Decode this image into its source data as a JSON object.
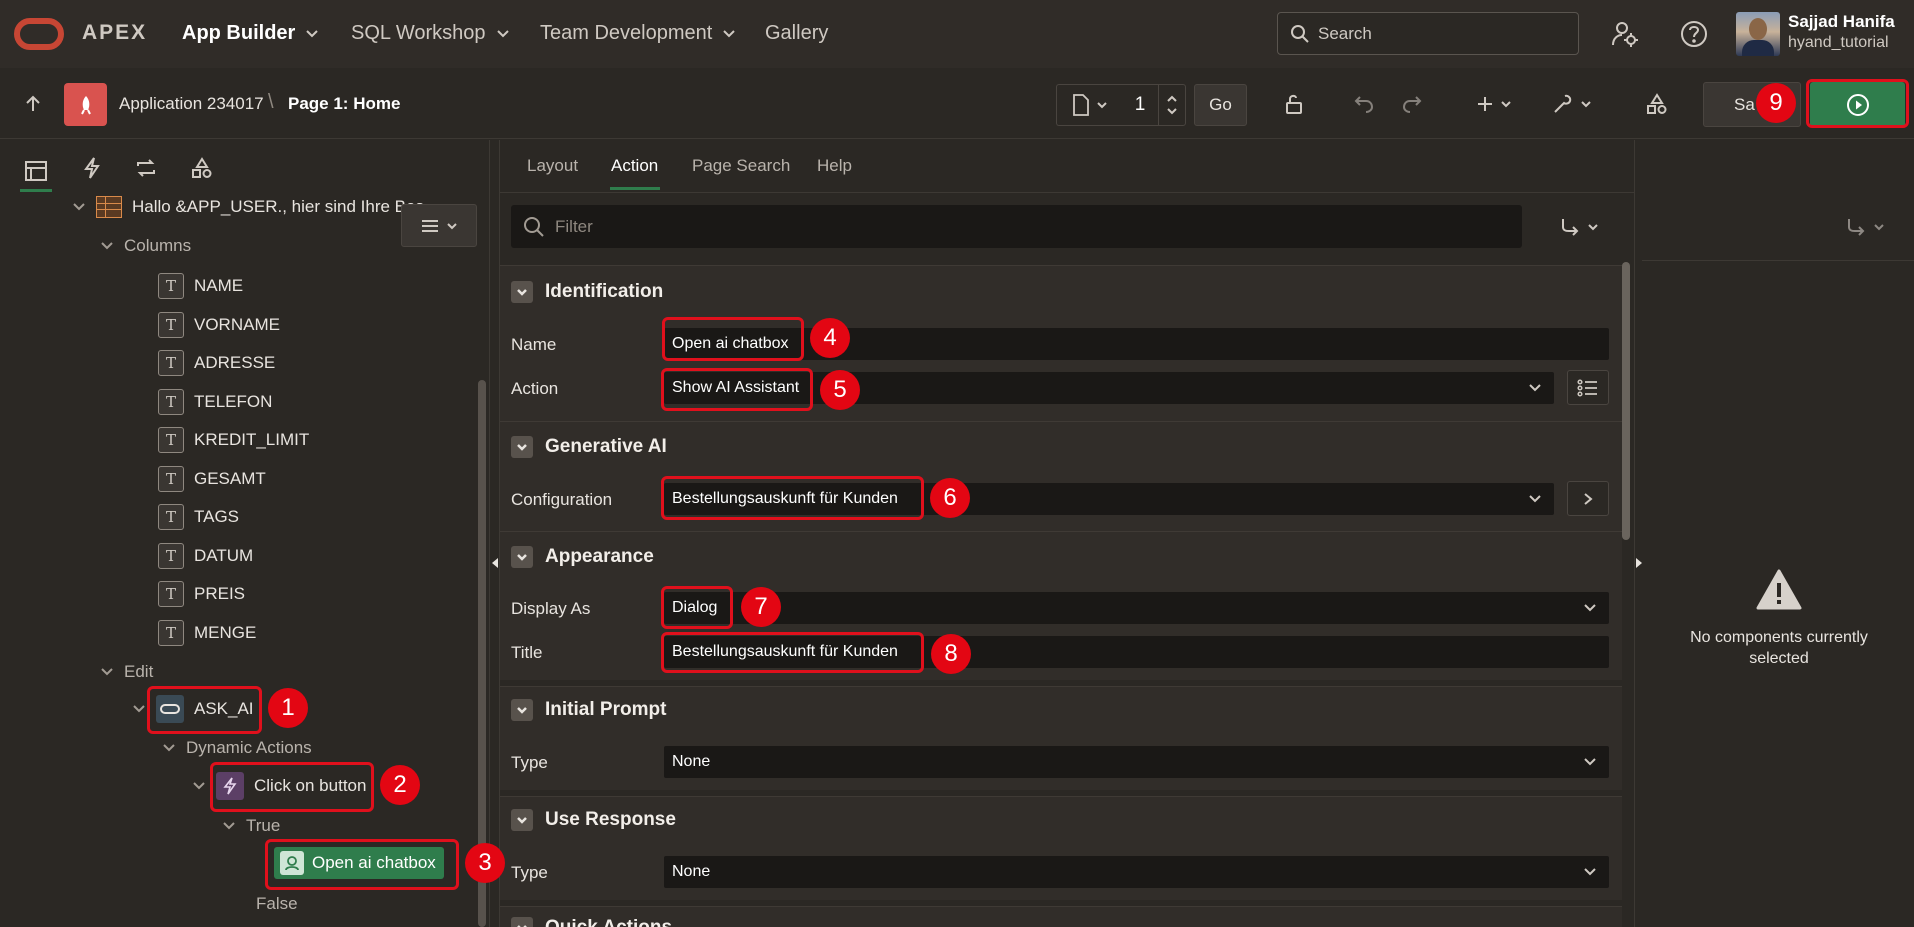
{
  "topnav": {
    "brand": "APEX",
    "items": [
      {
        "label": "App Builder",
        "active": true,
        "has_menu": true
      },
      {
        "label": "SQL Workshop",
        "has_menu": true
      },
      {
        "label": "Team Development",
        "has_menu": true
      },
      {
        "label": "Gallery",
        "has_menu": false
      }
    ],
    "search_placeholder": "Search",
    "user": {
      "name": "Sajjad Hanifa",
      "workspace": "hyand_tutorial"
    }
  },
  "toolbar": {
    "app_link": "Application 234017",
    "page_title": "Page 1: Home",
    "page_number": "1",
    "go_label": "Go",
    "save_label": "Sa",
    "colors": {
      "run_button": "#2f7d4c",
      "app_icon": "#d9534f"
    }
  },
  "tree": {
    "region_label": "Hallo &APP_USER., hier sind Ihre Bes",
    "columns_label": "Columns",
    "columns": [
      "NAME",
      "VORNAME",
      "ADRESSE",
      "TELEFON",
      "KREDIT_LIMIT",
      "GESAMT",
      "TAGS",
      "DATUM",
      "PREIS",
      "MENGE"
    ],
    "edit_label": "Edit",
    "button_label": "ASK_AI",
    "dynamic_actions_label": "Dynamic Actions",
    "da_label": "Click on button",
    "true_label": "True",
    "action_label": "Open ai chatbox",
    "false_label": "False"
  },
  "tabs": [
    {
      "label": "Layout"
    },
    {
      "label": "Action",
      "active": true
    },
    {
      "label": "Page Search"
    },
    {
      "label": "Help"
    }
  ],
  "filter_placeholder": "Filter",
  "sections": {
    "identification": {
      "title": "Identification",
      "name_label": "Name",
      "name_value": "Open ai chatbox",
      "action_label": "Action",
      "action_value": "Show AI Assistant"
    },
    "generative_ai": {
      "title": "Generative AI",
      "config_label": "Configuration",
      "config_value": "Bestellungsauskunft für Kunden"
    },
    "appearance": {
      "title": "Appearance",
      "display_label": "Display As",
      "display_value": "Dialog",
      "title_label": "Title",
      "title_value": "Bestellungsauskunft für Kunden"
    },
    "initial_prompt": {
      "title": "Initial Prompt",
      "type_label": "Type",
      "type_value": "None"
    },
    "use_response": {
      "title": "Use Response",
      "type_label": "Type",
      "type_value": "None"
    },
    "quick_actions": {
      "title": "Quick Actions"
    }
  },
  "right_panel": {
    "empty_text": "No components currently selected"
  },
  "badges": [
    "1",
    "2",
    "3",
    "4",
    "5",
    "6",
    "7",
    "8",
    "9"
  ],
  "colors": {
    "badge": "#e30613",
    "highlight": "#e0101c",
    "action_chip": "#2f7d4c",
    "oracle_logo": "#c74634"
  }
}
